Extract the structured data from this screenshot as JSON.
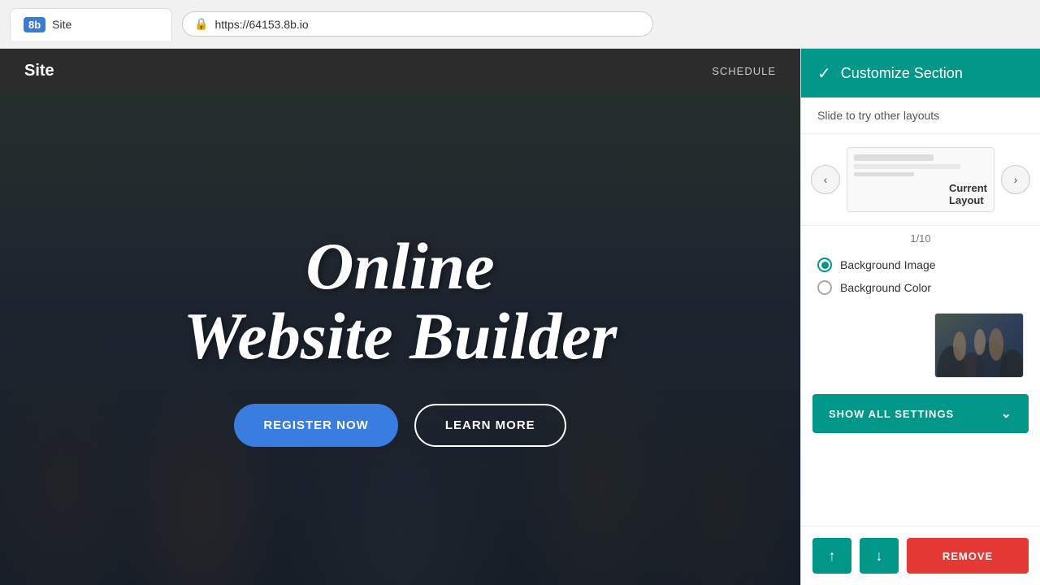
{
  "browser": {
    "brand": "8b",
    "tab_title": "Site",
    "url": "https://64153.8b.io",
    "lock_icon": "🔒"
  },
  "site_navbar": {
    "logo": "Site",
    "nav_links": [
      "SCHEDULE"
    ]
  },
  "hero": {
    "title_line1": "Online",
    "title_line2": "Website Builder",
    "btn_register": "REGISTER NOW",
    "btn_learn": "LEARN MORE"
  },
  "right_panel": {
    "header": {
      "check_icon": "✓",
      "title": "Customize Section"
    },
    "subtitle": "Slide to try other layouts",
    "layout_preview_label": "Current\nLayout",
    "layout_counter": "1/10",
    "background_image_label": "Background Image",
    "background_color_label": "Background Color",
    "show_all_settings": "SHOW ALL SETTINGS",
    "btn_up": "↑",
    "btn_down": "↓",
    "btn_remove": "REMOVE"
  }
}
